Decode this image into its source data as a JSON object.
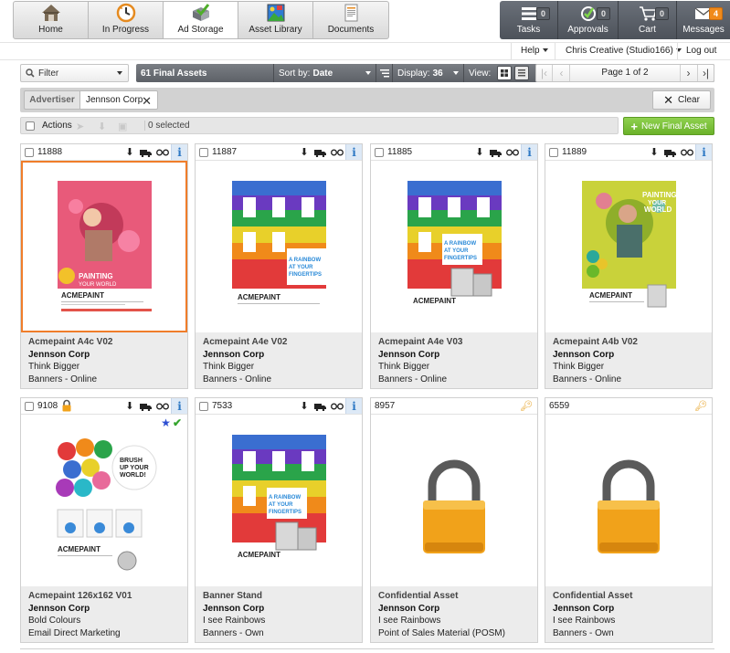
{
  "nav": {
    "tabs": [
      {
        "label": "Home",
        "icon": "home-icon"
      },
      {
        "label": "In Progress",
        "icon": "in-progress-icon"
      },
      {
        "label": "Ad Storage",
        "icon": "ad-storage-icon",
        "active": true
      },
      {
        "label": "Asset Library",
        "icon": "asset-library-icon"
      },
      {
        "label": "Documents",
        "icon": "documents-icon"
      }
    ],
    "right": [
      {
        "label": "Tasks",
        "count": "0",
        "icon": "tasks-icon"
      },
      {
        "label": "Approvals",
        "count": "0",
        "icon": "approvals-icon"
      },
      {
        "label": "Cart",
        "count": "0",
        "icon": "cart-icon"
      },
      {
        "label": "Messages",
        "count": "4",
        "icon": "messages-icon"
      }
    ]
  },
  "userbar": {
    "help": "Help",
    "user": "Chris Creative (Studio166)",
    "logout": "Log out"
  },
  "toolbar": {
    "filter": "Filter",
    "assets_count": "61 Final Assets",
    "sort_label": "Sort by:",
    "sort_value": "Date",
    "display_label": "Display:",
    "display_value": "36",
    "view_label": "View:",
    "page_text": "Page 1 of 2"
  },
  "filters": {
    "chip_label": "Advertiser",
    "chip_value": "Jennson Corp",
    "clear": "Clear"
  },
  "actions": {
    "label": "Actions",
    "selected": "0 selected",
    "new_final_asset": "New Final Asset"
  },
  "colors": {
    "accent_orange": "#f07d2a",
    "green": "#6bb22a",
    "info_blue": "#2d78c4",
    "dark_bar": "#5d6167"
  },
  "cards": [
    {
      "id": "11888",
      "title": "Acmepaint A4c V02",
      "company": "Jennson Corp",
      "campaign": "Think Bigger",
      "category": "Banners - Online",
      "thumb": "painting-pink",
      "selected": true
    },
    {
      "id": "11887",
      "title": "Acmepaint A4e V02",
      "company": "Jennson Corp",
      "campaign": "Think Bigger",
      "category": "Banners - Online",
      "thumb": "rainbow-house"
    },
    {
      "id": "11885",
      "title": "Acmepaint A4e V03",
      "company": "Jennson Corp",
      "campaign": "Think Bigger",
      "category": "Banners - Online",
      "thumb": "rainbow-cans"
    },
    {
      "id": "11889",
      "title": "Acmepaint A4b V02",
      "company": "Jennson Corp",
      "campaign": "Think Bigger",
      "category": "Banners - Online",
      "thumb": "painting-green"
    },
    {
      "id": "9108",
      "title": "Acmepaint 126x162 V01",
      "company": "Jennson Corp",
      "campaign": "Bold Colours",
      "category": "Email Direct Marketing",
      "thumb": "brush-up",
      "locked_small": true,
      "badges": true
    },
    {
      "id": "7533",
      "title": "Banner Stand",
      "company": "Jennson Corp",
      "campaign": "I see Rainbows",
      "category": "Banners - Own",
      "thumb": "rainbow-cans"
    },
    {
      "id": "8957",
      "title": "Confidential Asset",
      "company": "Jennson Corp",
      "campaign": "I see Rainbows",
      "category": "Point of Sales Material (POSM)",
      "thumb": "padlock",
      "confidential": true
    },
    {
      "id": "6559",
      "title": "Confidential Asset",
      "company": "Jennson Corp",
      "campaign": "I see Rainbows",
      "category": "Banners - Own",
      "thumb": "padlock",
      "confidential": true
    }
  ],
  "thumb_text": {
    "painting": "PAINTING YOUR WORLD",
    "rainbow": "A RAINBOW AT YOUR FINGERTIPS",
    "brush": "BRUSH UP YOUR WORLD",
    "brand": "ACMEPAINT"
  }
}
